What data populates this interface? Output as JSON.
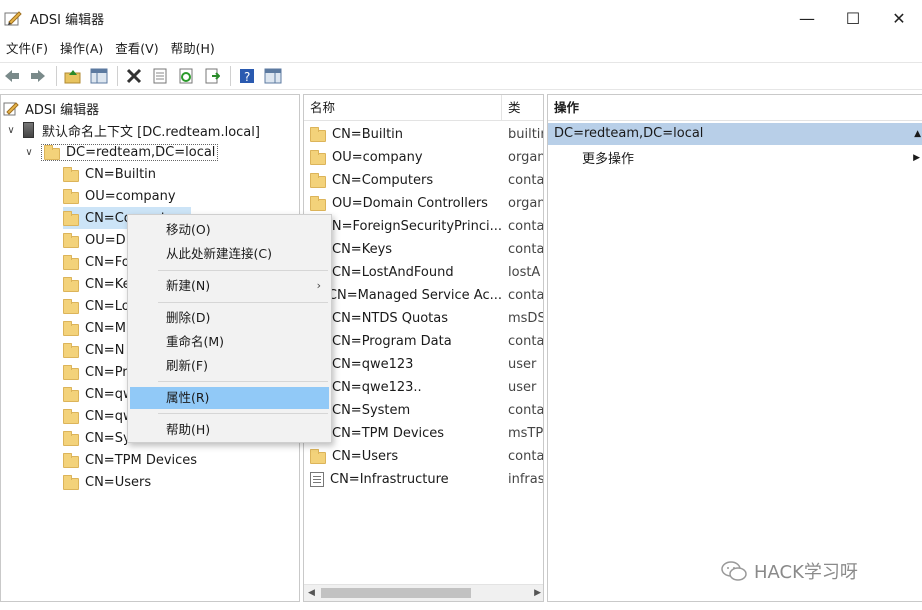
{
  "window": {
    "title": "ADSI 编辑器",
    "minimize": "—",
    "maximize": "☐",
    "close": "✕"
  },
  "menu": [
    "文件(F)",
    "操作(A)",
    "查看(V)",
    "帮助(H)"
  ],
  "tree": {
    "root": "ADSI 编辑器",
    "context": "默认命名上下文 [DC.redteam.local]",
    "domain": "DC=redteam,DC=local",
    "children": [
      "CN=Builtin",
      "OU=company",
      "CN=Computers",
      "OU=D",
      "CN=Fo",
      "CN=Ke",
      "CN=Lo",
      "CN=M",
      "CN=N",
      "CN=Pr",
      "CN=qw",
      "CN=qw",
      "CN=Sy",
      "CN=TPM Devices",
      "CN=Users"
    ]
  },
  "list": {
    "col_name": "名称",
    "col_type": "类",
    "rows": [
      {
        "name": "CN=Builtin",
        "type": "builtin",
        "icon": "folder"
      },
      {
        "name": "OU=company",
        "type": "organ",
        "icon": "folder"
      },
      {
        "name": "CN=Computers",
        "type": "conta",
        "icon": "folder"
      },
      {
        "name": "OU=Domain Controllers",
        "type": "organ",
        "icon": "folder"
      },
      {
        "name": "CN=ForeignSecurityPrinci...",
        "type": "conta",
        "icon": "folder"
      },
      {
        "name": "CN=Keys",
        "type": "conta",
        "icon": "folder"
      },
      {
        "name": "CN=LostAndFound",
        "type": "lostA",
        "icon": "folder"
      },
      {
        "name": "CN=Managed Service Ac...",
        "type": "conta",
        "icon": "folder"
      },
      {
        "name": "CN=NTDS Quotas",
        "type": "msDS",
        "icon": "folder"
      },
      {
        "name": "CN=Program Data",
        "type": "conta",
        "icon": "folder"
      },
      {
        "name": "CN=qwe123",
        "type": "user",
        "icon": "folder"
      },
      {
        "name": "CN=qwe123..",
        "type": "user",
        "icon": "folder"
      },
      {
        "name": "CN=System",
        "type": "conta",
        "icon": "folder"
      },
      {
        "name": "CN=TPM Devices",
        "type": "msTP",
        "icon": "folder"
      },
      {
        "name": "CN=Users",
        "type": "conta",
        "icon": "folder"
      },
      {
        "name": "CN=Infrastructure",
        "type": "infras",
        "icon": "document"
      }
    ]
  },
  "actions": {
    "header": "操作",
    "selected": "DC=redteam,DC=local",
    "more": "更多操作"
  },
  "context_menu": {
    "items": [
      "移动(O)",
      "从此处新建连接(C)",
      "新建(N)",
      "删除(D)",
      "重命名(M)",
      "刷新(F)",
      "属性(R)",
      "帮助(H)"
    ],
    "selected_item": "属性(R)"
  },
  "watermark": "HACK学习呀",
  "colors": {
    "selection": "#91c9f7",
    "action_selected": "#b8cfe8",
    "folder": "#f3d27a"
  }
}
